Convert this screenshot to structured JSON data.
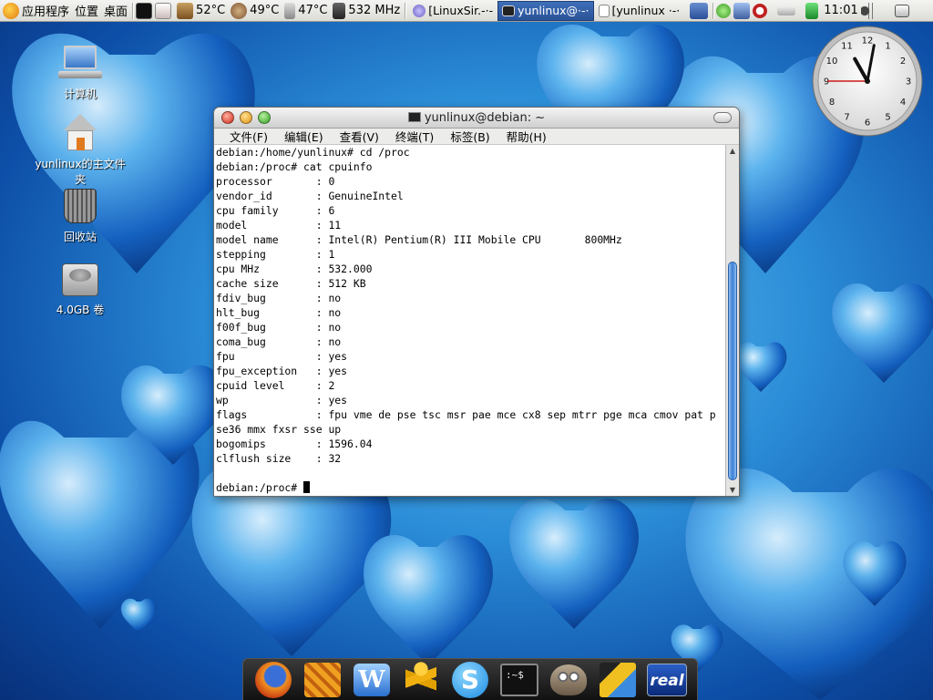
{
  "top_panel": {
    "applications_menu": "应用程序",
    "places_menu": "位置",
    "desktop_menu": "桌面",
    "sensors": [
      {
        "icon": "cpu-temp-icon",
        "value": "52°C"
      },
      {
        "icon": "fan-temp-icon",
        "value": "49°C"
      },
      {
        "icon": "disk-temp-icon",
        "value": "47°C"
      },
      {
        "icon": "cpu-freq-icon",
        "value": "532 MHz"
      }
    ],
    "tasks": [
      {
        "label": "[LinuxSir.-·-",
        "active": false
      },
      {
        "label": "yunlinux@·-·",
        "active": true
      },
      {
        "label": "[yunlinux ·-·",
        "active": false
      }
    ],
    "clock": "11:01"
  },
  "desktop_icons": [
    {
      "label": "计算机",
      "icon": "computer-icon"
    },
    {
      "label": "yunlinux的主文件夹",
      "icon": "home-folder-icon"
    },
    {
      "label": "回收站",
      "icon": "trash-icon"
    },
    {
      "label": "4.0GB 卷",
      "icon": "drive-icon"
    }
  ],
  "terminal": {
    "title": "yunlinux@debian: ~",
    "menus": [
      "文件(F)",
      "编辑(E)",
      "查看(V)",
      "终端(T)",
      "标签(B)",
      "帮助(H)"
    ],
    "lines": [
      "debian:/home/yunlinux# cd /proc",
      "debian:/proc# cat cpuinfo",
      "processor       : 0",
      "vendor_id       : GenuineIntel",
      "cpu family      : 6",
      "model           : 11",
      "model name      : Intel(R) Pentium(R) III Mobile CPU       800MHz",
      "stepping        : 1",
      "cpu MHz         : 532.000",
      "cache size      : 512 KB",
      "fdiv_bug        : no",
      "hlt_bug         : no",
      "f00f_bug        : no",
      "coma_bug        : no",
      "fpu             : yes",
      "fpu_exception   : yes",
      "cpuid level     : 2",
      "wp              : yes",
      "flags           : fpu vme de pse tsc msr pae mce cx8 sep mtrr pge mca cmov pat p",
      "se36 mmx fxsr sse up",
      "bogomips        : 1596.04",
      "clflush size    : 32",
      ""
    ],
    "prompt": "debian:/proc# "
  },
  "analog_clock": {
    "hours": 11,
    "minutes": 1,
    "seconds": 45
  },
  "dock": {
    "items": [
      {
        "icon": "firefox-icon"
      },
      {
        "icon": "pidgin-icon"
      },
      {
        "icon": "writer-icon"
      },
      {
        "icon": "aim-icon"
      },
      {
        "icon": "skype-icon"
      },
      {
        "icon": "terminal-icon",
        "text": ":~$"
      },
      {
        "icon": "gimp-icon"
      },
      {
        "icon": "media-player-icon"
      },
      {
        "icon": "realplayer-icon",
        "text": "real"
      }
    ]
  }
}
